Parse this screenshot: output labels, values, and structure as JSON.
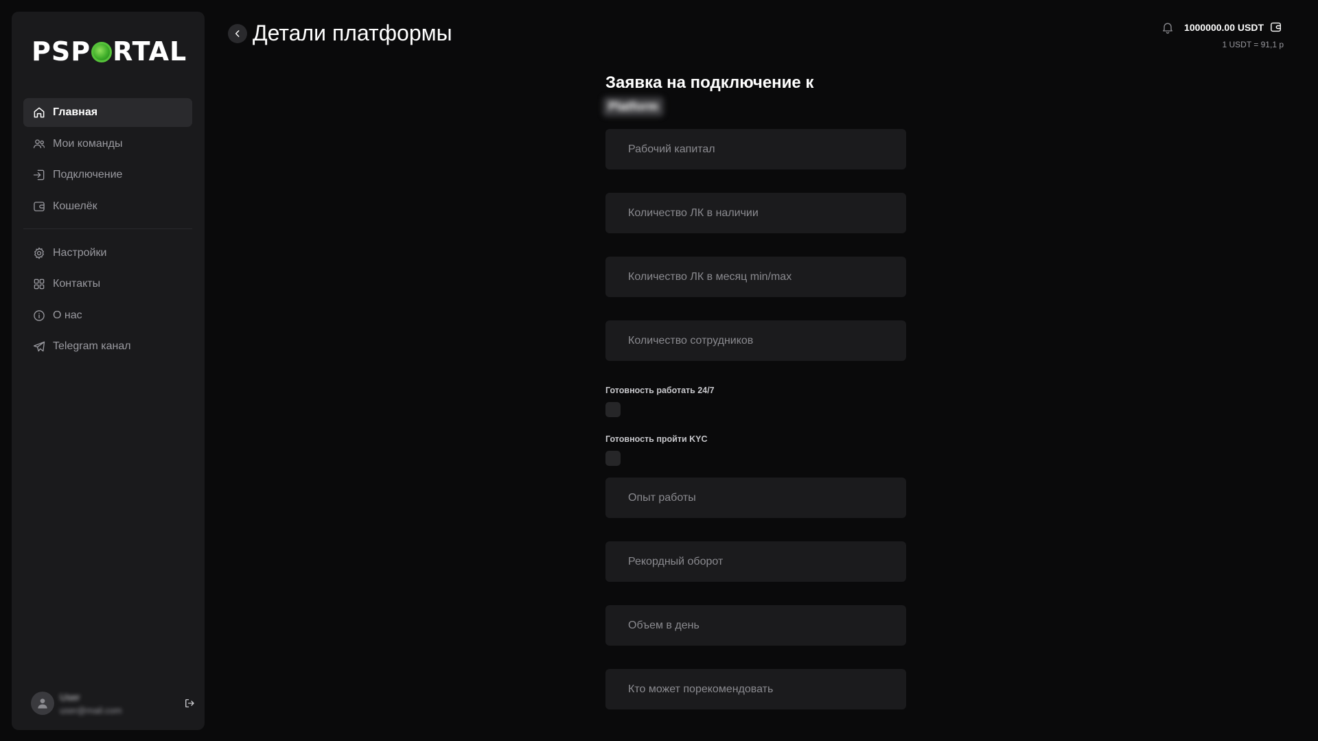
{
  "app": {
    "logo_text_pre": "PSP",
    "logo_text_post": "RTAL"
  },
  "sidebar": {
    "items": [
      {
        "label": "Главная",
        "icon": "home-icon",
        "active": true
      },
      {
        "label": "Мои команды",
        "icon": "users-icon"
      },
      {
        "label": "Подключение",
        "icon": "login-icon"
      },
      {
        "label": "Кошелёк",
        "icon": "wallet-icon"
      },
      {
        "label": "Настройки",
        "icon": "gear-icon"
      },
      {
        "label": "Контакты",
        "icon": "grid-icon"
      },
      {
        "label": "О нас",
        "icon": "info-icon"
      },
      {
        "label": "Telegram канал",
        "icon": "telegram-icon"
      }
    ],
    "user": {
      "name": "User",
      "email": "user@mail.com"
    }
  },
  "header": {
    "title": "Детали платформы",
    "balance": "1000000.00 USDT",
    "rate": "1 USDT = 91,1 р"
  },
  "form": {
    "title": "Заявка на подключение к",
    "title_hidden": "Platform",
    "fields": {
      "working_capital": "Рабочий капитал",
      "lk_available": "Количество ЛК в наличии",
      "lk_month": "Количество ЛК в месяц min/max",
      "employees": "Количество сотрудников",
      "experience": "Опыт работы",
      "record_turnover": "Рекордный оборот",
      "daily_volume": "Объем в день",
      "recommender": "Кто может порекомендовать"
    },
    "checks": {
      "ready_247": "Готовность работать 24/7",
      "ready_kyc": "Готовность пройти KYC"
    }
  },
  "colors": {
    "background": "#0a0a0b",
    "sidebar": "#1a1a1c",
    "field": "#1b1b1d",
    "logo_accent": "#3fae2a"
  }
}
